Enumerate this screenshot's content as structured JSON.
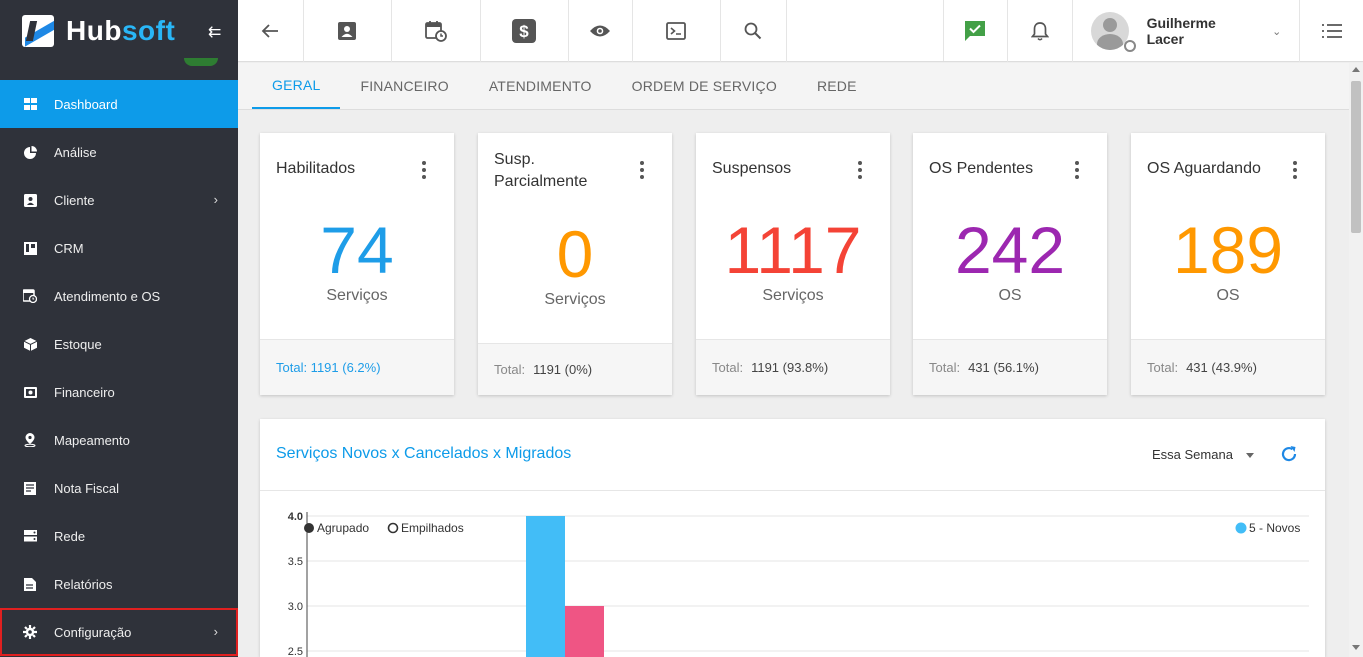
{
  "sidebar": {
    "logo": {
      "hub": "Hub",
      "soft": "soft"
    },
    "items": [
      {
        "label": "Dashboard",
        "icon": "dashboard-icon",
        "active": true
      },
      {
        "label": "Análise",
        "icon": "pie-chart-icon"
      },
      {
        "label": "Cliente",
        "icon": "contact-card-icon",
        "has_children": true
      },
      {
        "label": "CRM",
        "icon": "kanban-icon"
      },
      {
        "label": "Atendimento e OS",
        "icon": "calendar-clock-icon"
      },
      {
        "label": "Estoque",
        "icon": "box-icon"
      },
      {
        "label": "Financeiro",
        "icon": "money-icon"
      },
      {
        "label": "Mapeamento",
        "icon": "map-pin-icon"
      },
      {
        "label": "Nota Fiscal",
        "icon": "document-icon"
      },
      {
        "label": "Rede",
        "icon": "server-icon"
      },
      {
        "label": "Relatórios",
        "icon": "report-icon"
      },
      {
        "label": "Configuração",
        "icon": "gear-icon",
        "has_children": true,
        "highlighted": true
      }
    ]
  },
  "topbar": {
    "buttons": [
      "back-arrow-icon",
      "contact-card-icon",
      "calendar-clock-icon",
      "dollar-icon",
      "eye-icon",
      "terminal-icon",
      "search-icon"
    ],
    "right_buttons": [
      "chat-check-icon",
      "bell-icon"
    ],
    "user_name": "Guilherme Lacer",
    "menu_icon": "list-menu-icon"
  },
  "tabs": [
    {
      "label": "GERAL",
      "active": true
    },
    {
      "label": "FINANCEIRO"
    },
    {
      "label": "ATENDIMENTO"
    },
    {
      "label": "ORDEM DE SERVIÇO"
    },
    {
      "label": "REDE"
    }
  ],
  "cards": [
    {
      "title": "Habilitados",
      "value": "74",
      "unit": "Serviços",
      "color": "#1e9de8",
      "footer_label": "Total: 1191 (6.2%)",
      "footer_value": ""
    },
    {
      "title": "Susp. Parcialmente",
      "value": "0",
      "unit": "Serviços",
      "color": "#ff9800",
      "footer_label": "Total:",
      "footer_value": "1191 (0%)"
    },
    {
      "title": "Suspensos",
      "value": "1117",
      "unit": "Serviços",
      "color": "#f44336",
      "footer_label": "Total:",
      "footer_value": "1191 (93.8%)"
    },
    {
      "title": "OS Pendentes",
      "value": "242",
      "unit": "OS",
      "color": "#9c27b0",
      "footer_label": "Total:",
      "footer_value": "431 (56.1%)"
    },
    {
      "title": "OS Aguardando",
      "value": "189",
      "unit": "OS",
      "color": "#ff9800",
      "footer_label": "Total:",
      "footer_value": "431 (43.9%)"
    }
  ],
  "panel": {
    "title": "Serviços Novos x Cancelados x Migrados",
    "period": "Essa Semana",
    "mode_options": [
      "Agrupado",
      "Empilhados"
    ],
    "selected_mode": "Agrupado"
  },
  "chart_data": {
    "type": "bar",
    "title": "",
    "y_ticks": [
      "4.0",
      "3.5",
      "3.0",
      "2.5"
    ],
    "ylim_visible": [
      2.5,
      4.0
    ],
    "series": [
      {
        "name": "5 - Novos",
        "color": "#42bdf7",
        "values": [
          4
        ]
      },
      {
        "color": "#ef5584",
        "values": [
          3
        ]
      }
    ],
    "legend_position": "top-right",
    "grid": true
  }
}
